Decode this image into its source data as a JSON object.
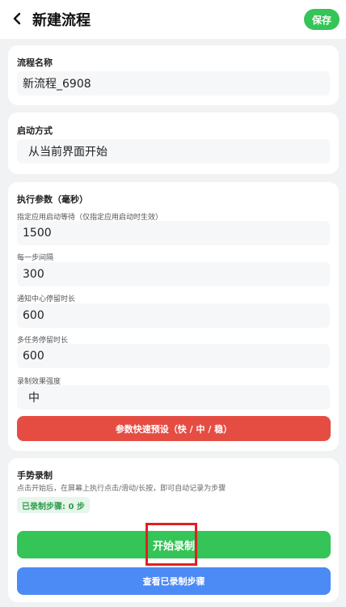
{
  "header": {
    "title": "新建流程",
    "save_label": "保存"
  },
  "name_section": {
    "label": "流程名称",
    "value": "新流程_6908"
  },
  "start_section": {
    "label": "启动方式",
    "value": "从当前界面开始"
  },
  "params_section": {
    "label": "执行参数（毫秒）",
    "fields": [
      {
        "label": "指定应用启动等待（仅指定应用启动时生效）",
        "value": "1500"
      },
      {
        "label": "每一步间隔",
        "value": "300"
      },
      {
        "label": "通知中心停留时长",
        "value": "600"
      },
      {
        "label": "多任务停留时长",
        "value": "600"
      },
      {
        "label": "录制效果强度",
        "value": "中"
      }
    ],
    "preset_button": "参数快速预设（快 / 中 / 稳）"
  },
  "gesture_section": {
    "label": "手势录制",
    "hint": "点击开始后，在屏幕上执行点击/滑动/长按，即可自动记录为步骤",
    "recorded_badge": "已录制步骤: 0 步",
    "start_button": "开始录制",
    "view_button": "查看已录制步骤"
  },
  "colors": {
    "green": "#34c457",
    "red": "#e54d43",
    "blue": "#4c8af5",
    "highlight": "#e02020"
  }
}
